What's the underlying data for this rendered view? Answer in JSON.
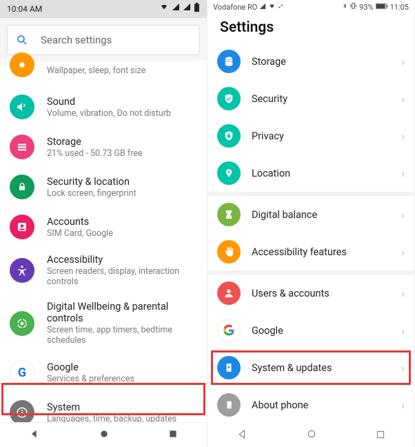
{
  "left": {
    "statusbar": {
      "time": "10:04 AM"
    },
    "search_placeholder": "Search settings",
    "items": [
      {
        "title": "",
        "sub": "Wallpaper, sleep, font size",
        "icon": "display-icon",
        "color": "#ff9800"
      },
      {
        "title": "Sound",
        "sub": "Volume, vibration, Do not disturb",
        "icon": "sound-icon",
        "color": "#00bfa5"
      },
      {
        "title": "Storage",
        "sub": "21% used - 50.73 GB free",
        "icon": "storage-icon",
        "color": "#ec407a"
      },
      {
        "title": "Security & location",
        "sub": "Lock screen, fingerprint",
        "icon": "lock-icon",
        "color": "#0f9d58"
      },
      {
        "title": "Accounts",
        "sub": "SIM Card, Google",
        "icon": "accounts-icon",
        "color": "#e91e63"
      },
      {
        "title": "Accessibility",
        "sub": "Screen readers, display, interaction controls",
        "icon": "accessibility-icon",
        "color": "#673ab7"
      },
      {
        "title": "Digital Wellbeing & parental controls",
        "sub": "Screen time, app timers, bedtime schedules",
        "icon": "wellbeing-icon",
        "color": "#4caf50"
      },
      {
        "title": "Google",
        "sub": "Services & preferences",
        "icon": "google-icon",
        "color": "#1a73e8"
      },
      {
        "title": "System",
        "sub": "Languages, time, backup, updates",
        "icon": "info-icon",
        "color": "#757575"
      }
    ]
  },
  "right": {
    "statusbar": {
      "carrier": "Vodafone RO",
      "battery": "93%",
      "time": "11:05"
    },
    "header": "Settings",
    "groups": [
      [
        {
          "label": "Storage",
          "icon": "storage-icon",
          "color": "#1e88e5"
        },
        {
          "label": "Security",
          "icon": "shield-icon",
          "color": "#00c4a7"
        },
        {
          "label": "Privacy",
          "icon": "privacy-icon",
          "color": "#00c4a7"
        },
        {
          "label": "Location",
          "icon": "location-icon",
          "color": "#00c4a7"
        }
      ],
      [
        {
          "label": "Digital balance",
          "icon": "balance-icon",
          "color": "#7cb342"
        },
        {
          "label": "Accessibility features",
          "icon": "hand-icon",
          "color": "#ff9800"
        }
      ],
      [
        {
          "label": "Users & accounts",
          "icon": "user-icon",
          "color": "#ef5350"
        },
        {
          "label": "Google",
          "icon": "google-g-icon",
          "color": "#ffffff"
        },
        {
          "label": "System & updates",
          "icon": "system-icon",
          "color": "#1e88e5",
          "highlight": true
        },
        {
          "label": "About phone",
          "icon": "phone-icon",
          "color": "#9e9e9e"
        }
      ]
    ]
  }
}
